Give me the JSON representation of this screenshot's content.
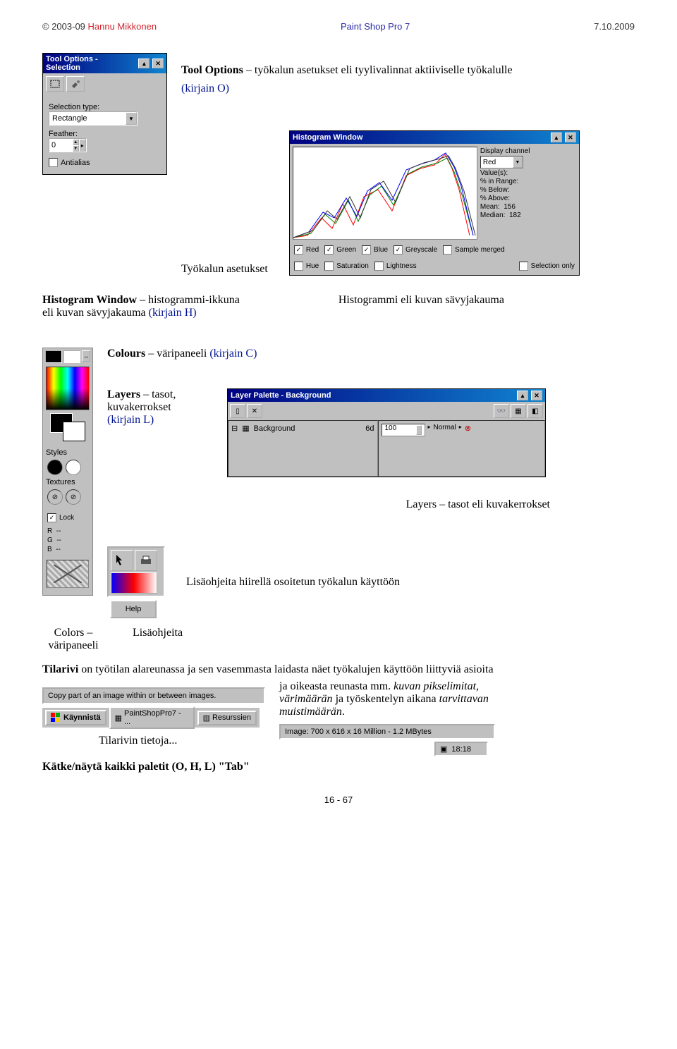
{
  "header": {
    "copyright": "© 2003-09 ",
    "author": "Hannu Mikkonen",
    "center": "Paint Shop Pro 7",
    "right": "7.10.2009"
  },
  "toolOptions": {
    "title": "Tool Options - Selection",
    "selTypeLabel": "Selection type:",
    "selTypeValue": "Rectangle",
    "featherLabel": "Feather:",
    "featherValue": "0",
    "antialias": "Antialias"
  },
  "text": {
    "toolOptionsLine1a": "Tool Options",
    "toolOptionsLine1b": " – työkalun asetukset eli tyylivalinnat aktiiviselle työkalulle",
    "toolOptionsLine2": "(kirjain O)",
    "tyokalunAsetukset": "Työkalun asetukset",
    "histWinA": "Histogram Window",
    "histWinB": " – histogrammi-ikkuna",
    "histWinC": "eli kuvan sävyjakauma ",
    "histWinD": "(kirjain H)",
    "histogrammiCaption": "Histogrammi eli kuvan sävyjakauma",
    "coloursA": "Colours",
    "coloursB": " – väripaneeli ",
    "coloursC": "(kirjain C)",
    "layersA": "Layers",
    "layersB": " – tasot,",
    "layersC": "kuvakerrokset",
    "layersD": "(kirjain L)",
    "layersCaption": "Layers – tasot eli kuvakerrokset",
    "lisaohjeitaLine": "Lisäohjeita hiirellä osoitetun työkalun käyttöön",
    "colorsCaption1": "Colors –",
    "colorsCaption2": "väripaneeli",
    "lisaohjeitaCaption": "Lisäohjeita",
    "tilariviA": "Tilarivi",
    "tilariviB": " on työtilan alareunassa ja sen vasemmasta laidasta näet työkalujen käyttöön liittyviä asioita",
    "tilariviC": "ja oikeasta reunasta  mm. ",
    "tilariviD": "kuvan pikselimitat",
    "tilariviE": ",",
    "tilariviF": "värimäärän",
    "tilariviG": " ja työskentelyn aikana ",
    "tilariviH": "tarvittavan",
    "tilariviI": "muistimäärän",
    "tilarivinTietoja": "Tilarivin tietoja...",
    "tabLineA": "Kätke/näytä kaikki paletit (O, H, L) ",
    "tabLineB": "\"Tab\""
  },
  "histogram": {
    "title": "Histogram Window",
    "displayChannel": "Display channel",
    "channelValue": "Red",
    "valuesLabel": "Value(s):",
    "pctRange": "% in Range:",
    "pctBelow": "% Below:",
    "pctAbove": "% Above:",
    "meanLbl": "Mean:",
    "meanVal": "156",
    "medianLbl": "Median:",
    "medianVal": "182",
    "checks": {
      "red": "Red",
      "green": "Green",
      "blue": "Blue",
      "greyscale": "Greyscale",
      "hue": "Hue",
      "saturation": "Saturation",
      "lightness": "Lightness",
      "sample": "Sample merged",
      "selonly": "Selection only"
    }
  },
  "colorsPanel": {
    "styles": "Styles",
    "textures": "Textures",
    "lock": "Lock",
    "r": "R",
    "g": "G",
    "b": "B",
    "dash": "--"
  },
  "layerPalette": {
    "title": "Layer Palette - Background",
    "background": "Background",
    "glasses": "6d",
    "hundred": "100",
    "normal": "Normal"
  },
  "helpBtn": "Help",
  "statusStrip": "Copy part of an image within or between images.",
  "taskbar": {
    "start": "Käynnistä",
    "paint": "PaintShopPro7 - ...",
    "resurs": "Resurssien"
  },
  "imageStatus": "Image:   700 x 616 x 16 Million - 1.2 MBytes",
  "clock": "18:18",
  "footer": "16 - 67"
}
